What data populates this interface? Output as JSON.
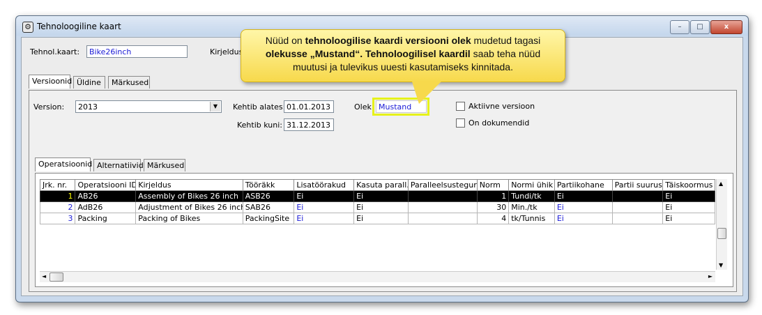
{
  "window": {
    "title": "Tehnoloogiline kaart",
    "buttons": {
      "minimize": "–",
      "maximize": "□",
      "close": "x"
    }
  },
  "header": {
    "tehnol_label": "Tehnol.kaart:",
    "tehnol_value": "Bike26inch",
    "kirjeldus_label": "Kirjeldus"
  },
  "top_tabs": [
    "Versioonid",
    "Üldine",
    "Märkused"
  ],
  "version": {
    "version_label": "Version:",
    "version_value": "2013",
    "kehtib_alates_label": "Kehtib alates:",
    "kehtib_alates_value": "01.01.2013",
    "kehtib_kuni_label": "Kehtib kuni:",
    "kehtib_kuni_value": "31.12.2013",
    "olek_label": "Olek:",
    "olek_value": "Mustand",
    "aktiivne_label": "Aktiivne versioon",
    "dokumendid_label": "On dokumendid",
    "aktiivne_checked": false,
    "dokumendid_checked": false
  },
  "inner_tabs": [
    "Operatsioonid",
    "Alternatiivid",
    "Märkused"
  ],
  "grid": {
    "columns": [
      "Jrk. nr.",
      "Operatsiooni ID",
      "Kirjeldus",
      "Tööräkk",
      "Lisatöörakud",
      "Kasuta parall.",
      "Paralleelsustegur",
      "Norm",
      "Normi ühik",
      "Partiikohane",
      "Partii suurus",
      "Täiskoormus"
    ],
    "rows": [
      [
        "1",
        "AB26",
        "Assembly of Bikes 26 inch",
        "ASB26",
        "Ei",
        "Ei",
        "",
        "1",
        "Tundi/tk",
        "Ei",
        "",
        "Ei"
      ],
      [
        "2",
        "AdB26",
        "Adjustment of Bikes 26 inch",
        "SAB26",
        "Ei",
        "Ei",
        "",
        "30",
        "Min./tk",
        "Ei",
        "",
        "Ei"
      ],
      [
        "3",
        "Packing",
        "Packing of Bikes",
        "PackingSite",
        "Ei",
        "Ei",
        "",
        "4",
        "tk/Tunnis",
        "Ei",
        "",
        "Ei"
      ]
    ],
    "selected_row": 0
  },
  "callout": {
    "line1_pre": "Nüüd on ",
    "line1_bold": "tehnoloogilise kaardi versiooni olek",
    "line1_post": " mudetud tagasi",
    "line2_bold1": "olekusse „Mustand“. Tehnoloogilisel kaardil",
    "line2_post": " saab teha nüüd",
    "line3": "muutusi ja tulevikus uuesti kasutamiseks kinnitada."
  },
  "colors": {
    "accent_blue": "#1a1ad6",
    "selected_bg": "#000000",
    "callout_bg": "#f7d94c"
  }
}
